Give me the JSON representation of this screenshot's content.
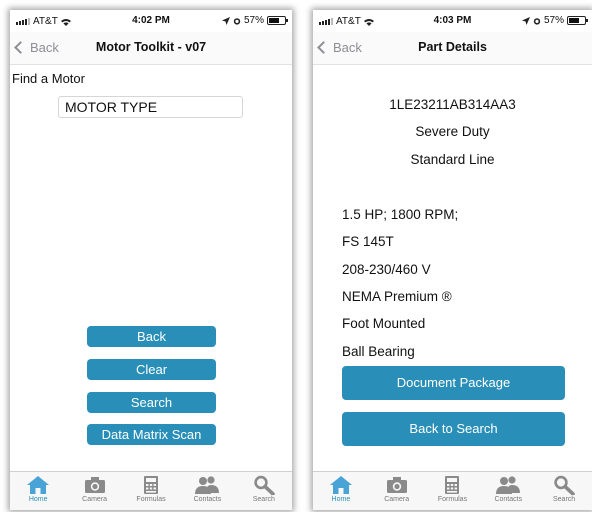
{
  "colors": {
    "accent": "#2a8fb8",
    "tab_active": "#4aa3d6",
    "tab_inactive": "#8a8a8a"
  },
  "left": {
    "status": {
      "carrier": "AT&T",
      "time": "4:02 PM",
      "battery": "57%"
    },
    "nav": {
      "back_label": "Back",
      "title": "Motor Toolkit - v07"
    },
    "find_label": "Find a Motor",
    "motor_input": {
      "value": "",
      "placeholder": "MOTOR TYPE"
    },
    "buttons": {
      "back": "Back",
      "clear": "Clear",
      "search": "Search",
      "scan": "Data Matrix Scan"
    }
  },
  "right": {
    "status": {
      "carrier": "AT&T",
      "time": "4:03 PM",
      "battery": "57%"
    },
    "nav": {
      "back_label": "Back",
      "title": "Part Details"
    },
    "part_number": "1LE23211AB314AA3",
    "duty": "Severe Duty",
    "line": "Standard Line",
    "specs": [
      "1.5 HP; 1800 RPM;",
      "FS 145T",
      "208-230/460 V",
      "NEMA Premium ®",
      "Foot Mounted",
      "Ball Bearing"
    ],
    "buttons": {
      "document": "Document Package",
      "back_to_search": "Back to Search"
    }
  },
  "tabs": [
    {
      "label": "Home",
      "icon": "home-icon",
      "active": true
    },
    {
      "label": "Camera",
      "icon": "camera-icon",
      "active": false
    },
    {
      "label": "Formulas",
      "icon": "calculator-icon",
      "active": false
    },
    {
      "label": "Contacts",
      "icon": "contacts-icon",
      "active": false
    },
    {
      "label": "Search",
      "icon": "search-icon",
      "active": false
    }
  ]
}
